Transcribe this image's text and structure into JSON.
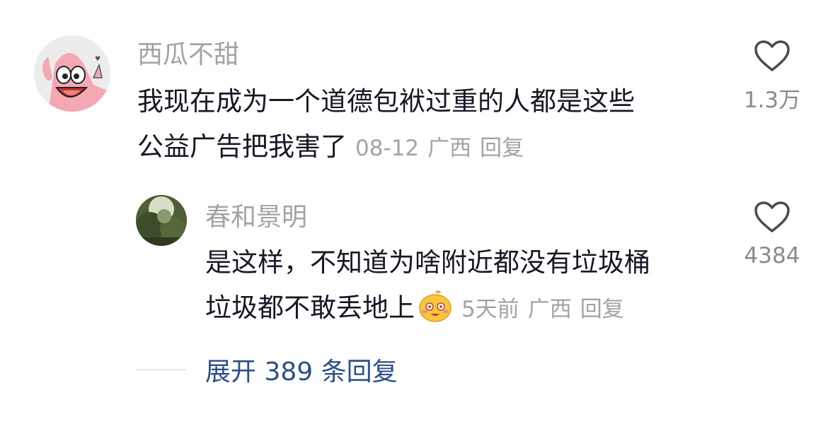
{
  "comments": [
    {
      "username": "西瓜不甜",
      "line1": "我现在成为一个道德包袱过重的人都是这些",
      "line2": "公益广告把我害了",
      "date": "08-12",
      "location": "广西",
      "reply_label": "回复",
      "likes": "1.3万",
      "avatar_icon": "patrick-star-avatar"
    },
    {
      "username": "春和景明",
      "line1": "是这样，不知道为啥附近都没有垃圾桶",
      "line2": "垃圾都不敢丢地上",
      "date": "5天前",
      "location": "广西",
      "reply_label": "回复",
      "likes": "4384",
      "avatar_icon": "tree-photo-avatar",
      "emoji_icon": "shy-face-emoji"
    }
  ],
  "expand_label": "展开 389 条回复",
  "colors": {
    "username": "#a3a3a3",
    "text": "#161823",
    "meta": "#a3a3a3",
    "expand": "#2d4f8a",
    "heart_stroke": "#4a4a4a"
  }
}
